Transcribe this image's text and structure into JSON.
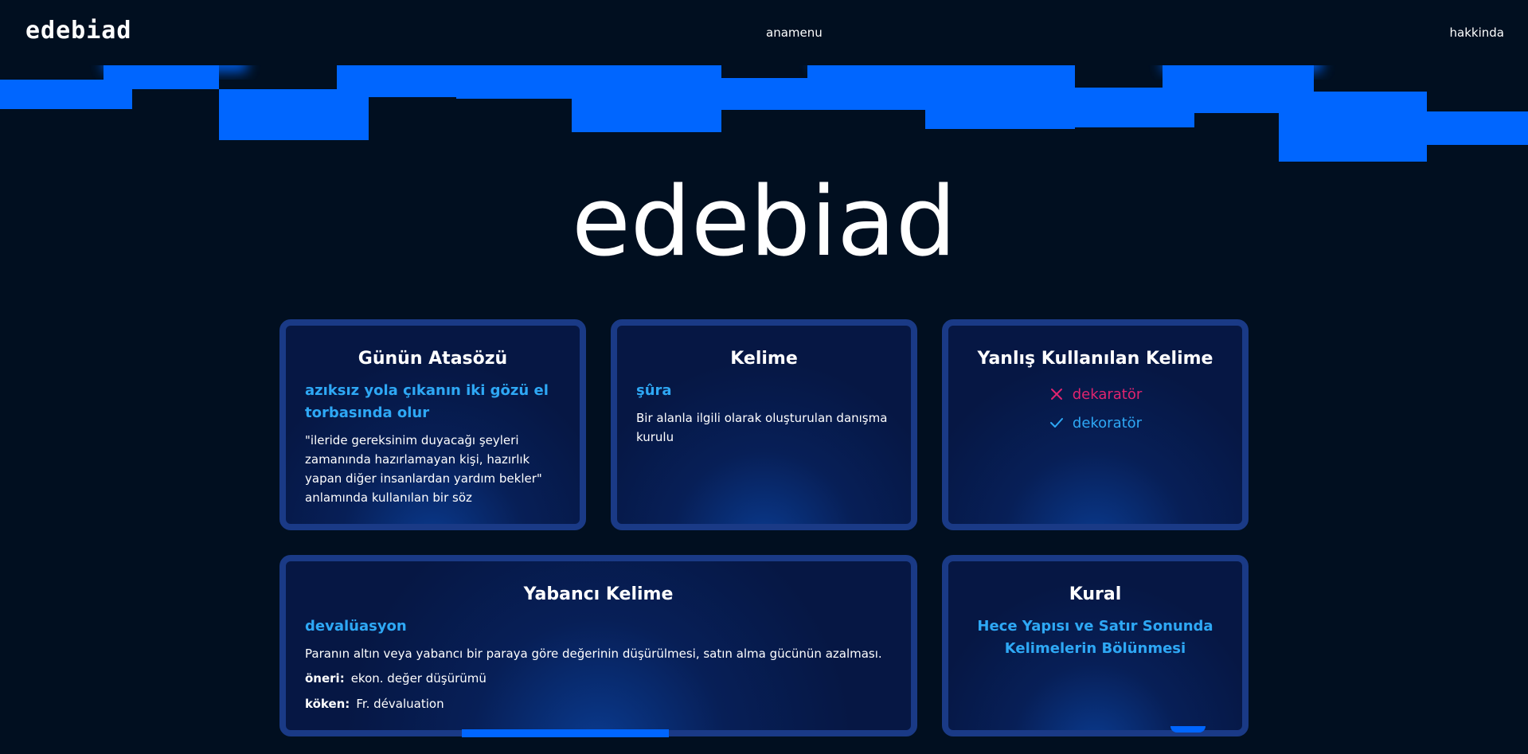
{
  "brand": {
    "logo_text": "edebiad",
    "accent_color": "#0066ff",
    "background_color": "#010f20",
    "headline_color": "#2ea8f5",
    "wrong_color": "#e0246f"
  },
  "nav": {
    "home_label": "anamenu",
    "about_label": "hakkinda"
  },
  "hero": {
    "title": "edebiad"
  },
  "proverb_card": {
    "title": "Günün Atasözü",
    "proverb": "azıksız yola çıkanın iki gözü el torbasında olur",
    "meaning": "\"ileride gereksinim duyacağı şeyleri zamanında hazırlamayan kişi, hazırlık yapan diğer insanlardan yardım bekler\" anlamında kullanılan bir söz"
  },
  "word_card": {
    "title": "Kelime",
    "word": "şûra",
    "definition": "Bir alanla ilgili olarak oluşturulan danışma kurulu"
  },
  "misused_card": {
    "title": "Yanlış Kullanılan Kelime",
    "wrong": "dekaratör",
    "correct": "dekoratör",
    "wrong_icon": "x-icon",
    "correct_icon": "check-icon"
  },
  "foreign_card": {
    "title": "Yabancı Kelime",
    "word": "devalüasyon",
    "definition": "Paranın altın veya yabancı bir paraya göre değerinin düşürülmesi, satın alma gücünün azalması.",
    "suggestion_label": "öneri:",
    "suggestion_value": "ekon. değer düşürümü",
    "origin_label": "köken:",
    "origin_value": "Fr. dévaluation"
  },
  "rule_card": {
    "title": "Kural",
    "rule": "Hece Yapısı ve Satır Sonunda Kelimelerin Bölünmesi"
  }
}
